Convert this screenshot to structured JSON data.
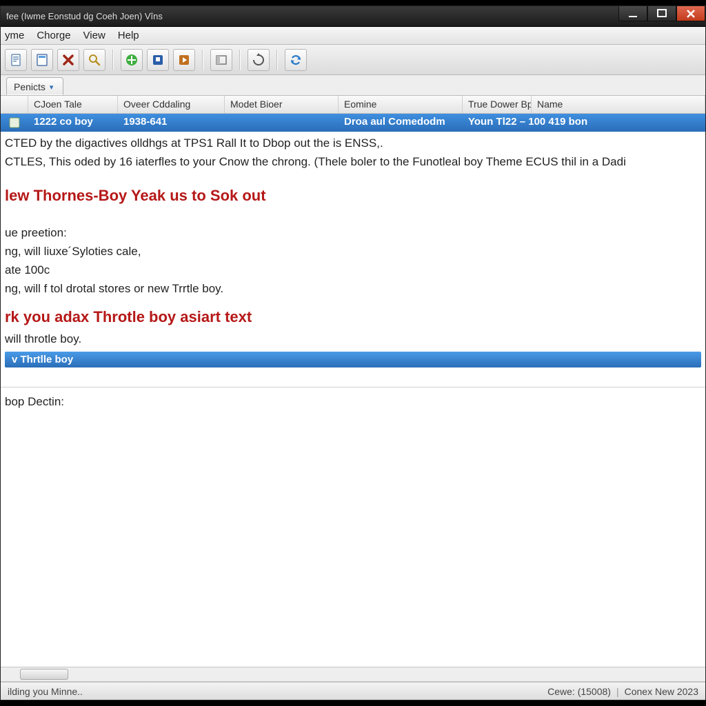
{
  "window": {
    "title": "fee  (Iwme Eonstud dg Coeh Joen)  Vîns"
  },
  "menu": {
    "items": [
      "yme",
      "Chorge",
      "View",
      "Help"
    ]
  },
  "toolbar": {
    "icons": [
      "doc-icon",
      "doc2-icon",
      "delete-icon",
      "search-icon",
      "sep",
      "run-icon",
      "flag-icon",
      "play-icon",
      "sep",
      "panel-icon",
      "sep",
      "refresh-icon",
      "sep",
      "sync-icon"
    ]
  },
  "tabs": {
    "active": "Penicts"
  },
  "columns": [
    "",
    "CJoen Tale",
    "Oveer Cddaling",
    "Modet Bioer",
    "Eomine",
    "True Dower Bp",
    "Name"
  ],
  "row": {
    "col1": "1222 co boy",
    "col2": "1938-641",
    "col3": "",
    "col4": "Droa aul Comedodm",
    "col5": "Youn Tl22 – 100 419 bon",
    "col6": "",
    "col7": ""
  },
  "body": {
    "p1": "CTED by the digactives olldhgs at TPS1 Rall It to Dbop out the is ENSS,.",
    "p2": "CTLES, This oded by 16 iaterfles to your Cnow the chrong. (Thele boler to the Funotleal boy Theme ECUS thil in a Dadi",
    "h1": "lew Thornes-Boy Yeak us to Sok out",
    "p3": "ue preetion:",
    "p4": "ng, will liuxe´Syloties cale,",
    "p5": "ate 100c",
    "p6": "ng, will f tol drotal stores or new Trrtle boy.",
    "h2": "rk you adax Throtle boy asiart text",
    "p7": "will throtle boy.",
    "btn": "v Thrtlle boy",
    "p8": "bop Dectin:"
  },
  "status": {
    "left": "ilding you Minne..",
    "center": "Cewe:  (15008)",
    "right": "Conex New 2023"
  }
}
